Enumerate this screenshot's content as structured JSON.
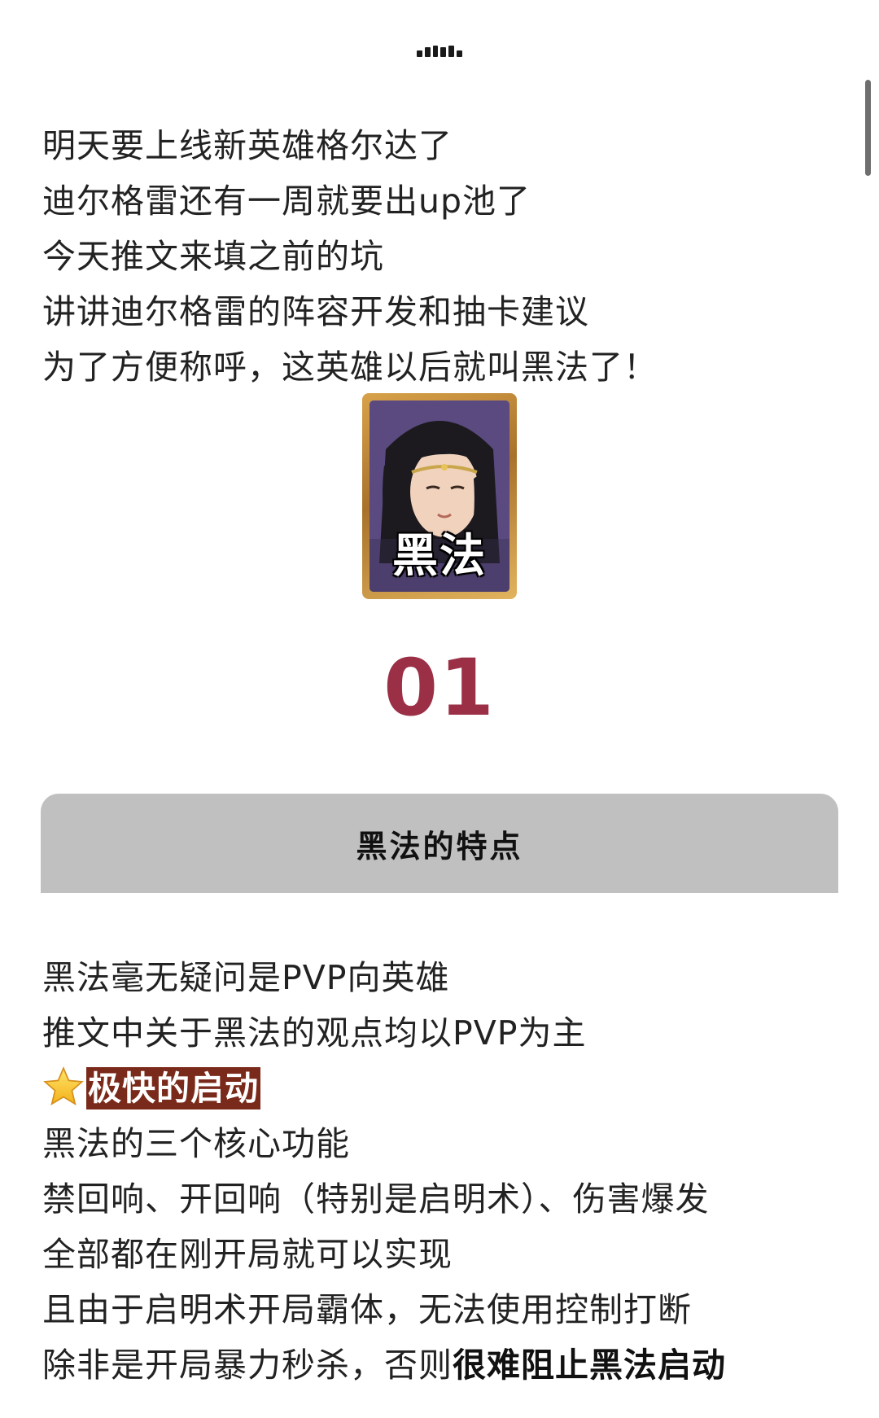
{
  "intro_lines": [
    "明天要上线新英雄格尔达了",
    "迪尔格雷还有一周就要出up池了",
    "今天推文来填之前的坑",
    "讲讲迪尔格雷的阵容开发和抽卡建议",
    "为了方便称呼，这英雄以后就叫黑法了！"
  ],
  "portrait": {
    "label": "黑法"
  },
  "section": {
    "number": "01",
    "title": "黑法的特点"
  },
  "body": {
    "line1": "黑法毫无疑问是PVP向英雄",
    "line2": "推文中关于黑法的观点均以PVP为主",
    "star_icon": "star-emoji-icon",
    "highlight": "极快的启动",
    "line4": "黑法的三个核心功能",
    "line5": "禁回响、开回响（特别是启明术）、伤害爆发",
    "line6": "全部都在刚开局就可以实现",
    "line7": "且由于启明术开局霸体，无法使用控制打断",
    "line8_plain": "除非是开局暴力秒杀，否则",
    "line8_bold": "很难阻止黑法启动"
  },
  "colors": {
    "section_number": "#9b2f46",
    "section_box": "#c0c0c0",
    "highlight_bg": "#7a2a1a",
    "portrait_frame": "#d8a24a"
  }
}
